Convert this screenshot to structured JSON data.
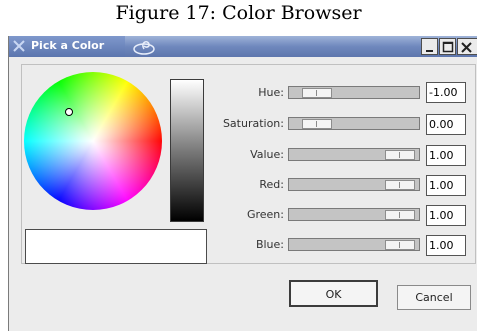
{
  "caption": "Figure 17:  Color Browser",
  "window": {
    "title": "Pick a Color",
    "controls": [
      "minimize-button",
      "maximize-button",
      "close-button"
    ]
  },
  "sliders": [
    {
      "name": "hue",
      "label": "Hue:",
      "value": "-1.00",
      "position_fraction": 0.0
    },
    {
      "name": "saturation",
      "label": "Saturation:",
      "value": "0.00",
      "position_fraction": 0.0
    },
    {
      "name": "value",
      "label": "Value:",
      "value": "1.00",
      "position_fraction": 1.0
    },
    {
      "name": "red",
      "label": "Red:",
      "value": "1.00",
      "position_fraction": 1.0
    },
    {
      "name": "green",
      "label": "Green:",
      "value": "1.00",
      "position_fraction": 1.0
    },
    {
      "name": "blue",
      "label": "Blue:",
      "value": "1.00",
      "position_fraction": 1.0
    }
  ],
  "buttons": {
    "ok": "OK",
    "cancel": "Cancel"
  },
  "colors": {
    "preview": "#ffffff",
    "titlebar": "#6f88bd",
    "dialog_bg": "#ececec"
  }
}
